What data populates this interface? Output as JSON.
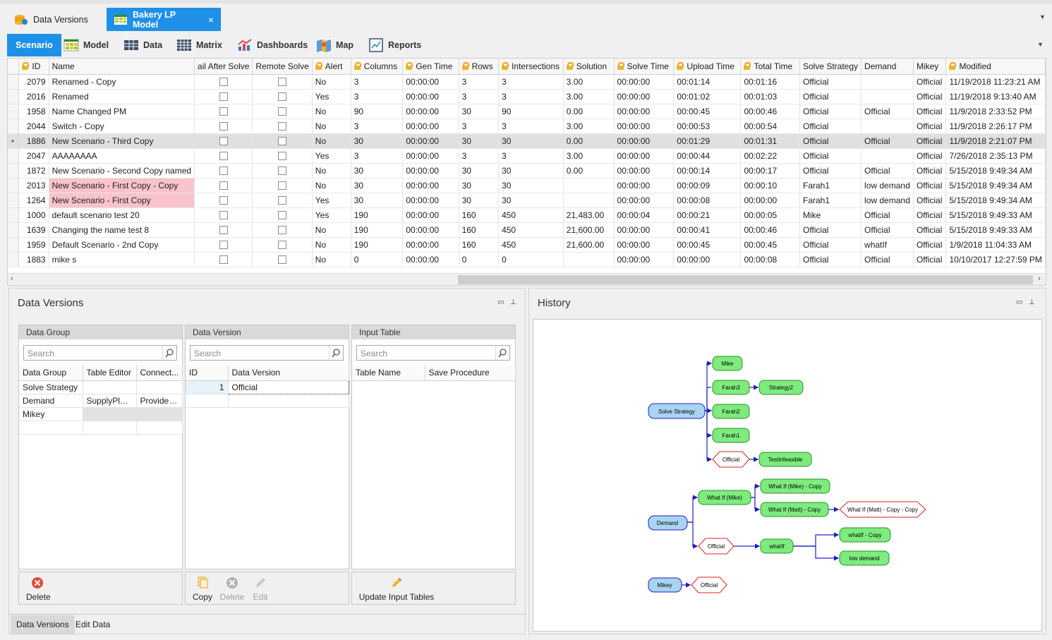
{
  "doc_tabs": [
    {
      "label": "Data Versions",
      "icon": "data-versions-icon"
    },
    {
      "label": "Bakery LP Model",
      "icon": "model-grid-icon",
      "close": "×"
    }
  ],
  "ribbon": {
    "tabs": [
      {
        "label": "Scenario",
        "icon": ""
      },
      {
        "label": "Model",
        "icon": "model-icon"
      },
      {
        "label": "Data",
        "icon": "data-table-icon"
      },
      {
        "label": "Matrix",
        "icon": "matrix-icon"
      },
      {
        "label": "Dashboards",
        "icon": "dashboards-icon"
      },
      {
        "label": "Map",
        "icon": "map-icon"
      },
      {
        "label": "Reports",
        "icon": "reports-icon"
      }
    ]
  },
  "grid": {
    "columns": [
      "ID",
      "Name",
      "ail After Solve",
      "Remote Solve",
      "Alert",
      "Columns",
      "Gen Time",
      "Rows",
      "Intersections",
      "Solution",
      "Solve Time",
      "Upload Time",
      "Total Time",
      "Solve Strategy",
      "Demand",
      "Mikey",
      "Modified"
    ],
    "selected_marker": "▸",
    "rows": [
      [
        "2079",
        "Renamed - Copy",
        "",
        "",
        "No",
        "3",
        "00:00:00",
        "3",
        "3",
        "3.00",
        "00:00:00",
        "00:01:14",
        "00:01:16",
        "Official",
        "",
        "Official",
        "11/19/2018 11:23:21 AM"
      ],
      [
        "2016",
        "Renamed",
        "",
        "",
        "Yes",
        "3",
        "00:00:00",
        "3",
        "3",
        "3.00",
        "00:00:00",
        "00:01:02",
        "00:01:03",
        "Official",
        "",
        "Official",
        "11/19/2018 9:13:40 AM"
      ],
      [
        "1958",
        "Name Changed PM",
        "",
        "",
        "No",
        "90",
        "00:00:00",
        "30",
        "90",
        "0.00",
        "00:00:00",
        "00:00:45",
        "00:00:46",
        "Official",
        "Official",
        "Official",
        "11/9/2018 2:33:52 PM"
      ],
      [
        "2044",
        "Switch - Copy",
        "",
        "",
        "No",
        "3",
        "00:00:00",
        "3",
        "3",
        "3.00",
        "00:00:00",
        "00:00:53",
        "00:00:54",
        "Official",
        "",
        "Official",
        "11/9/2018 2:26:17 PM"
      ],
      [
        "1886",
        "New Scenario - Third Copy",
        "",
        "",
        "No",
        "30",
        "00:00:00",
        "30",
        "30",
        "0.00",
        "00:00:00",
        "00:01:29",
        "00:01:31",
        "Official",
        "Official",
        "Official",
        "11/9/2018 2:21:07 PM"
      ],
      [
        "2047",
        "AAAAAAAA",
        "",
        "",
        "Yes",
        "3",
        "00:00:00",
        "3",
        "3",
        "3.00",
        "00:00:00",
        "00:00:44",
        "00:02:22",
        "Official",
        "",
        "Official",
        "7/26/2018 2:35:13 PM"
      ],
      [
        "1872",
        "New Scenario - Second Copy named",
        "",
        "",
        "No",
        "30",
        "00:00:00",
        "30",
        "30",
        "0.00",
        "00:00:00",
        "00:00:14",
        "00:00:17",
        "Official",
        "Official",
        "Official",
        "5/15/2018 9:49:34 AM"
      ],
      [
        "2013",
        "New Scenario - First Copy - Copy",
        "",
        "",
        "No",
        "30",
        "00:00:00",
        "30",
        "30",
        "",
        "00:00:00",
        "00:00:09",
        "00:00:10",
        "Farah1",
        "low demand",
        "Official",
        "5/15/2018 9:49:34 AM"
      ],
      [
        "1264",
        "New Scenario - First Copy",
        "",
        "",
        "Yes",
        "30",
        "00:00:00",
        "30",
        "30",
        "",
        "00:00:00",
        "00:00:08",
        "00:00:00",
        "Farah1",
        "low demand",
        "Official",
        "5/15/2018 9:49:34 AM"
      ],
      [
        "1000",
        "default scenario test 20",
        "",
        "",
        "Yes",
        "190",
        "00:00:00",
        "160",
        "450",
        "21,483.00",
        "00:00:04",
        "00:00:21",
        "00:00:05",
        "Mike",
        "Official",
        "Official",
        "5/15/2018 9:49:33 AM"
      ],
      [
        "1639",
        "Changing the name test 8",
        "",
        "",
        "No",
        "190",
        "00:00:00",
        "160",
        "450",
        "21,600.00",
        "00:00:00",
        "00:00:41",
        "00:00:46",
        "Official",
        "Official",
        "Official",
        "5/15/2018 9:49:33 AM"
      ],
      [
        "1959",
        "Default Scenario - 2nd Copy",
        "",
        "",
        "No",
        "190",
        "00:00:00",
        "160",
        "450",
        "21,600.00",
        "00:00:00",
        "00:00:45",
        "00:00:45",
        "Official",
        "whatIf",
        "Official",
        "1/9/2018 11:04:33 AM"
      ],
      [
        "1883",
        "mike s",
        "",
        "",
        "No",
        "0",
        "00:00:00",
        "0",
        "0",
        "",
        "00:00:00",
        "00:00:00",
        "00:00:08",
        "Official",
        "Official",
        "Official",
        "10/10/2017 12:27:59 PM"
      ]
    ]
  },
  "data_versions_panel": {
    "title": "Data Versions",
    "data_group": {
      "header": "Data Group",
      "search_placeholder": "Search",
      "columns": [
        "Data Group",
        "Table Editor",
        "Connect..."
      ],
      "rows": [
        [
          "Solve Strategy",
          "",
          ""
        ],
        [
          "Demand",
          "SupplyPlan...",
          "Provider..."
        ],
        [
          "Mikey",
          "",
          ""
        ]
      ]
    },
    "data_version": {
      "header": "Data Version",
      "search_placeholder": "Search",
      "columns": [
        "ID",
        "Data Version"
      ],
      "rows": [
        [
          "1",
          "Official"
        ]
      ]
    },
    "input_table": {
      "header": "Input Table",
      "search_placeholder": "Search",
      "columns": [
        "Table Name",
        "Save Procedure"
      ]
    },
    "actions": {
      "delete": "Delete",
      "copy": "Copy",
      "delete2": "Delete",
      "edit": "Edit",
      "update": "Update Input Tables"
    },
    "bottom_tabs": [
      "Data Versions",
      "Edit Data"
    ]
  },
  "history_panel": {
    "title": "History",
    "nodes": {
      "solve_strategy": "Solve Strategy",
      "mike": "Mike",
      "farah3": "Farah3",
      "strategy2": "Strategy2",
      "farah2": "Farah2",
      "farah1": "Farah1",
      "official1": "Official",
      "testinfeasible": "TestInfeasible",
      "demand": "Demand",
      "whatif_mike": "What If (Mike)",
      "whatif_mike_copy": "What If (Mike) - Copy",
      "whatif_matt_copy": "What If (Matt) - Copy",
      "whatif_matt_copy_copy": "What If (Matt) - Copy - Copy",
      "official2": "Official",
      "whatif": "whatIf",
      "whatif_copy": "whatIf - Copy",
      "low_demand": "low demand",
      "mikey": "Mikey",
      "official3": "Official"
    }
  },
  "colors": {
    "accent": "#1e90e8",
    "node_green": "#7deb7d",
    "node_blue": "#a8d4f0",
    "node_red": "#e02020",
    "pink_row": "#f9c3cb"
  }
}
